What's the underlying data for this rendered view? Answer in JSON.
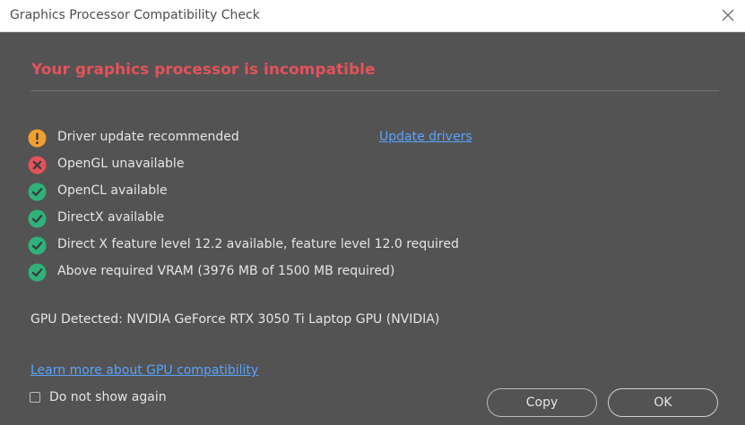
{
  "window": {
    "title": "Graphics Processor Compatibility Check",
    "close_icon": "close-icon"
  },
  "headline": "Your graphics processor is incompatible",
  "checks": [
    {
      "status": "warning",
      "icon": "warning-icon",
      "label": "Driver update recommended"
    },
    {
      "status": "error",
      "icon": "error-icon",
      "label": "OpenGL unavailable"
    },
    {
      "status": "ok",
      "icon": "check-icon",
      "label": "OpenCL available"
    },
    {
      "status": "ok",
      "icon": "check-icon",
      "label": "DirectX available"
    },
    {
      "status": "ok",
      "icon": "check-icon",
      "label": "Direct X feature level 12.2 available, feature level 12.0 required"
    },
    {
      "status": "ok",
      "icon": "check-icon",
      "label": "Above required VRAM (3976 MB of 1500 MB required)"
    }
  ],
  "update_link": "Update drivers",
  "gpu_detected": "GPU Detected: NVIDIA GeForce RTX 3050 Ti Laptop GPU (NVIDIA)",
  "learn_more": "Learn more about GPU compatibility",
  "do_not_show": {
    "label": "Do not show again",
    "checked": false
  },
  "buttons": {
    "copy": "Copy",
    "ok": "OK"
  },
  "colors": {
    "background": "#535353",
    "headline": "#e4525b",
    "warning": "#f0a030",
    "error": "#e4525b",
    "ok": "#2fb27a",
    "link": "#5aa4ff"
  }
}
